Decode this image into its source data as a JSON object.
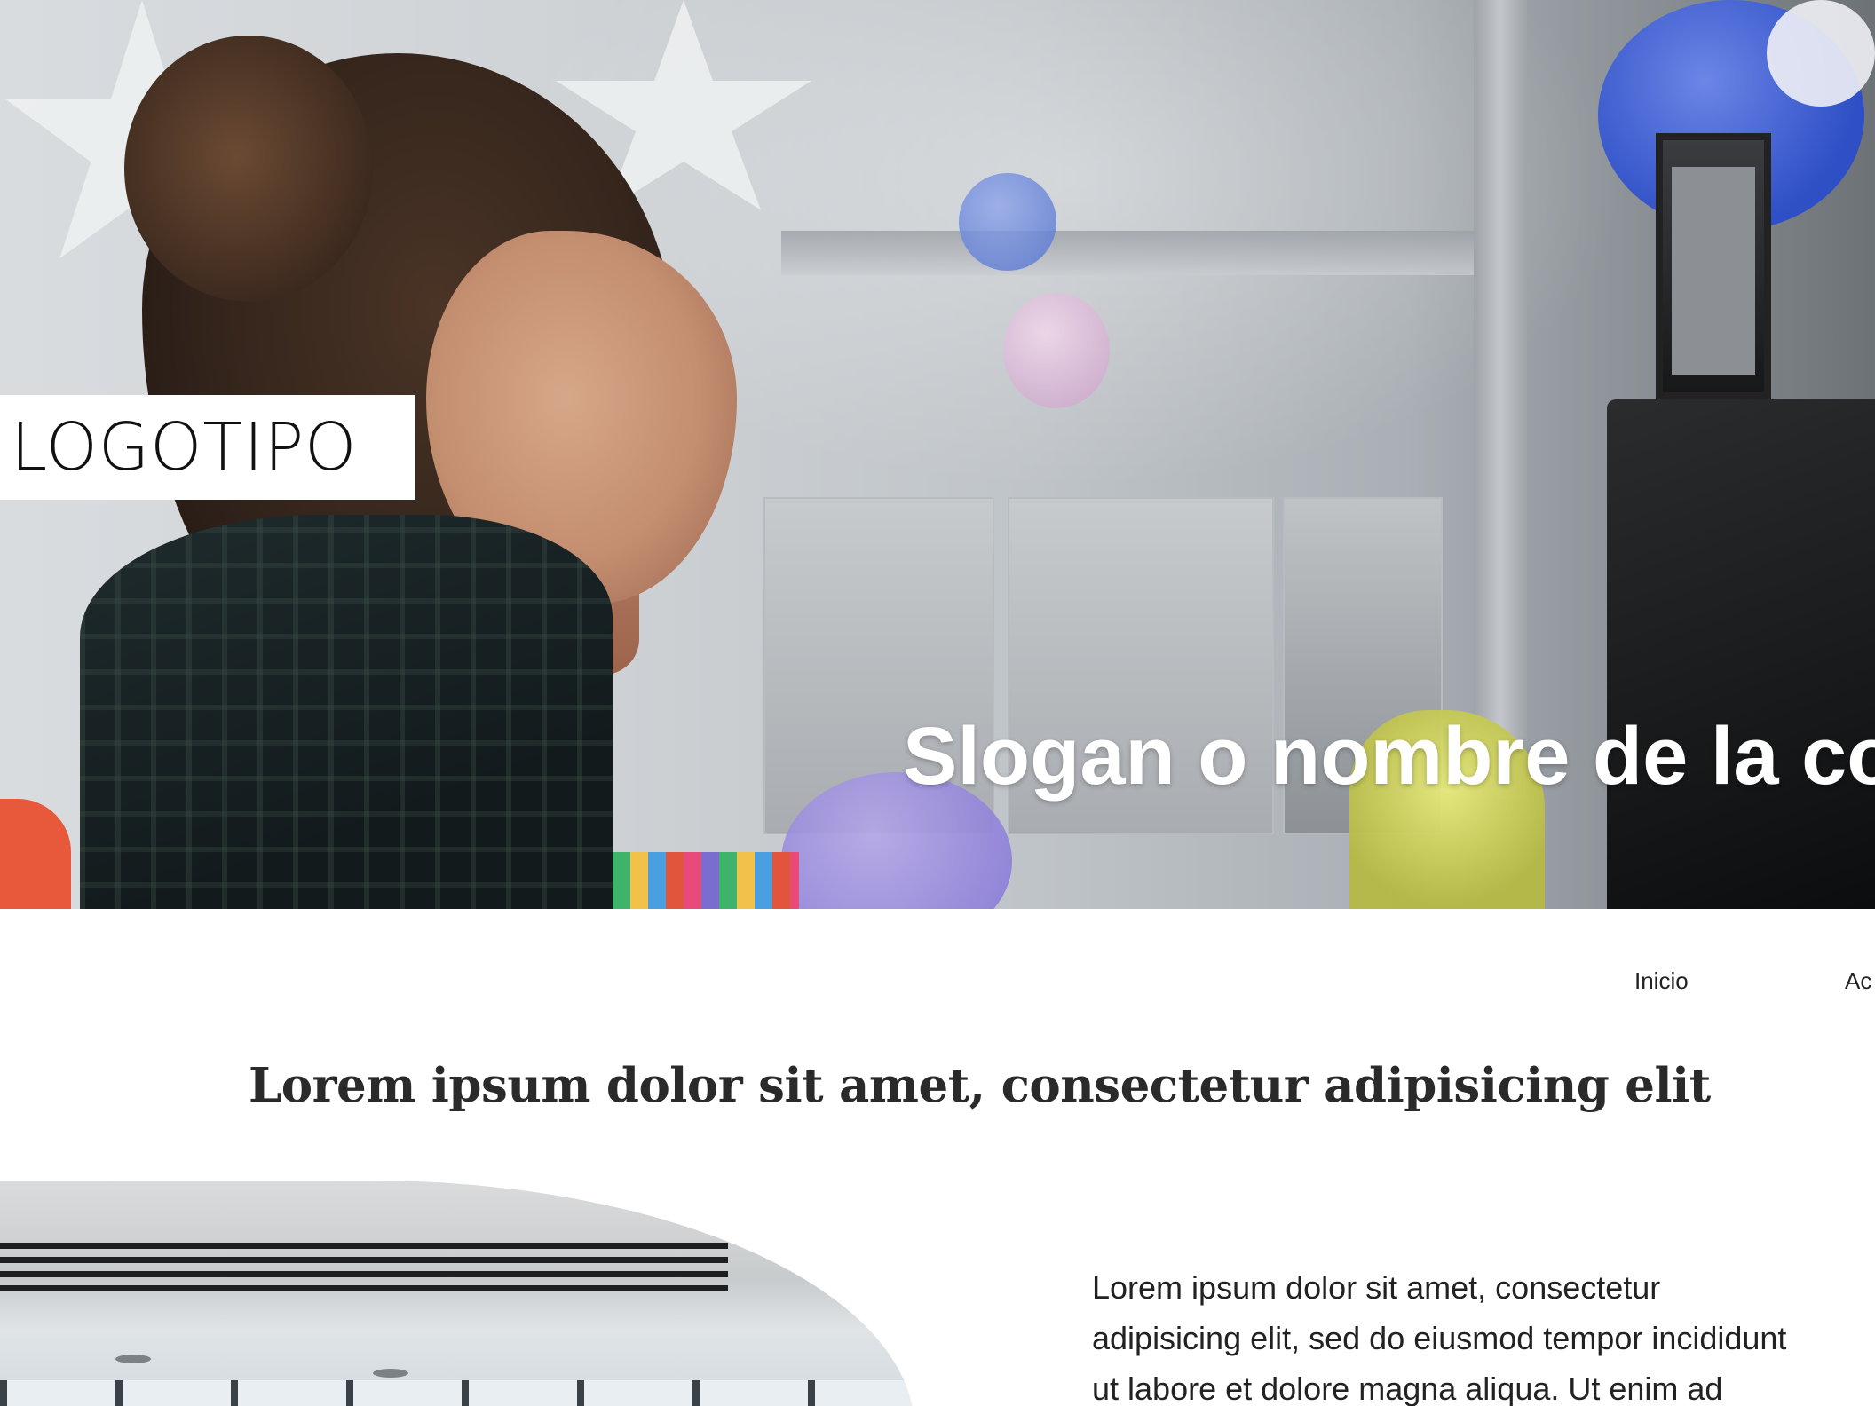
{
  "hero": {
    "logo": "LOGOTIPO",
    "slogan": "Slogan o nombre de la cor"
  },
  "nav": {
    "items": [
      "Inicio",
      "Ac"
    ]
  },
  "main": {
    "title": "Lorem ipsum dolor sit amet, consectetur adipisicing elit",
    "body": "Lorem ipsum dolor sit amet, consectetur\nadipisicing elit, sed do eiusmod tempor incididunt\nut labore et dolore magna aliqua. Ut enim ad"
  }
}
